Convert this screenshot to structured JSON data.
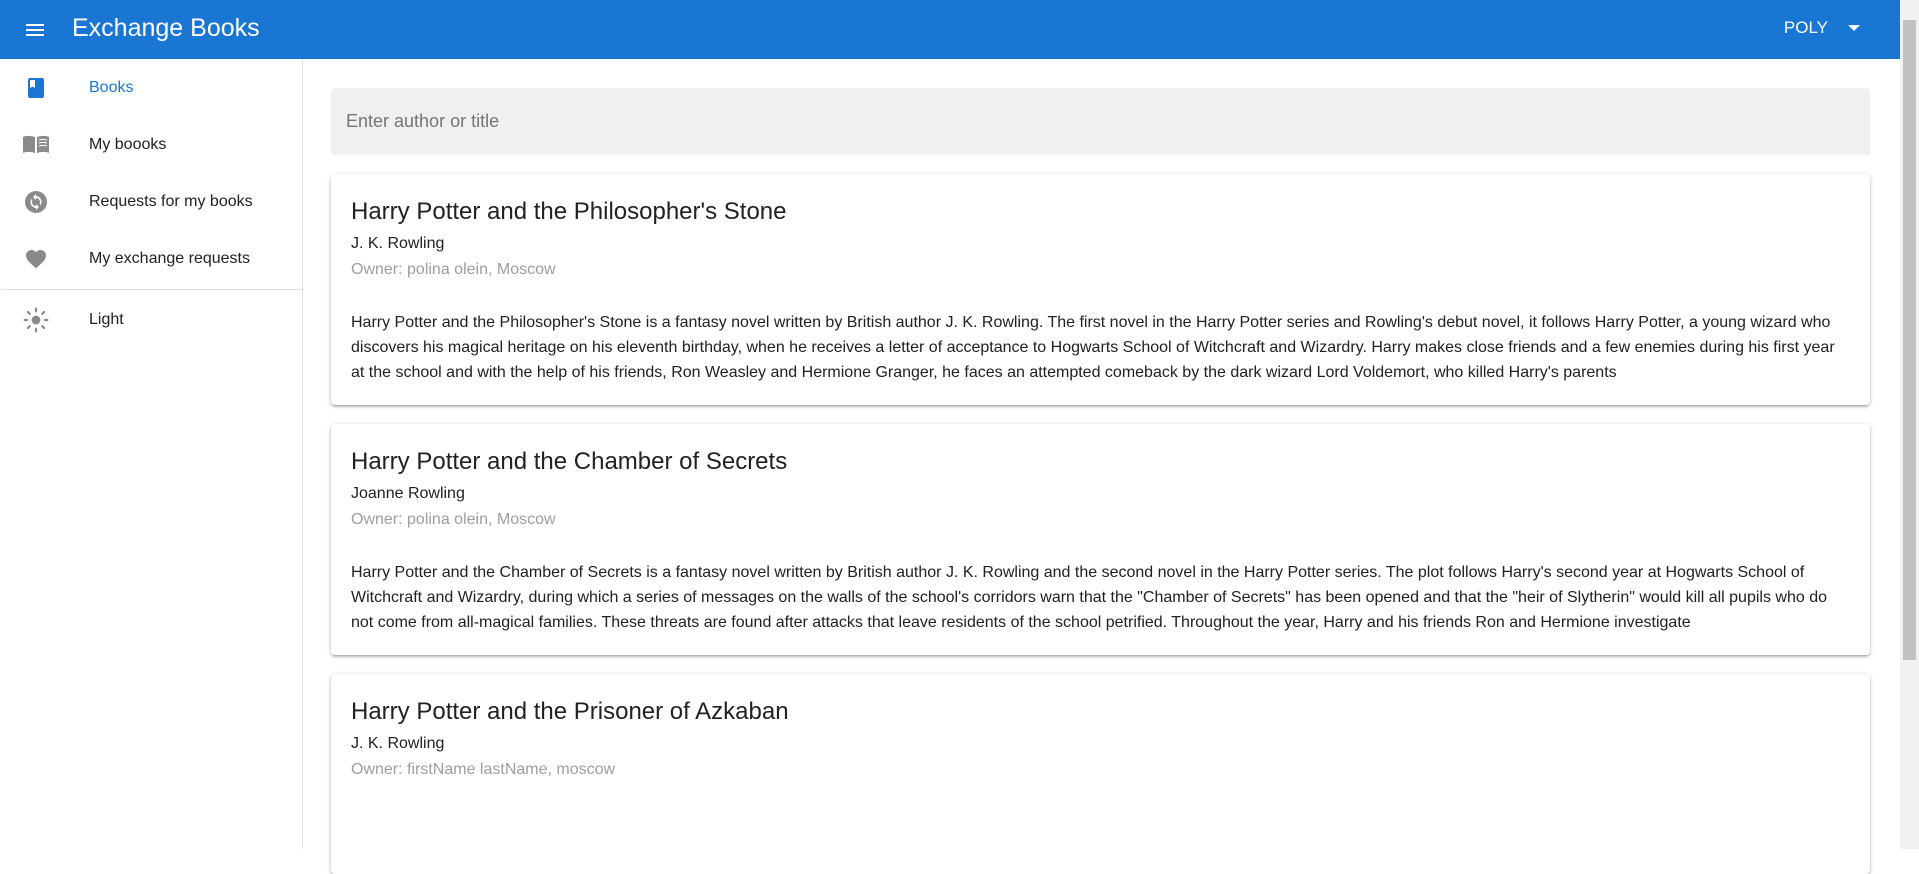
{
  "app": {
    "title": "Exchange Books",
    "brand_color": "#1976d2"
  },
  "user_menu": {
    "label": "POLY"
  },
  "sidebar": {
    "items": [
      {
        "label": "Books",
        "icon": "book-icon",
        "active": true
      },
      {
        "label": "My boooks",
        "icon": "open-book-icon",
        "active": false
      },
      {
        "label": "Requests for my books",
        "icon": "sync-icon",
        "active": false
      },
      {
        "label": "My exchange requests",
        "icon": "heart-icon",
        "active": false
      }
    ],
    "theme": {
      "label": "Light",
      "icon": "sun-icon"
    }
  },
  "search": {
    "placeholder": "Enter author or title",
    "value": ""
  },
  "books": [
    {
      "title": "Harry Potter and the Philosopher's Stone",
      "author": "J. K. Rowling",
      "owner": "Owner: polina olein, Moscow",
      "description": "Harry Potter and the Philosopher's Stone is a fantasy novel written by British author J. K. Rowling. The first novel in the Harry Potter series and Rowling's debut novel, it follows Harry Potter, a young wizard who discovers his magical heritage on his eleventh birthday, when he receives a letter of acceptance to Hogwarts School of Witchcraft and Wizardry. Harry makes close friends and a few enemies during his first year at the school and with the help of his friends, Ron Weasley and Hermione Granger, he faces an attempted comeback by the dark wizard Lord Voldemort, who killed Harry's parents"
    },
    {
      "title": "Harry Potter and the Chamber of Secrets",
      "author": "Joanne Rowling",
      "owner": "Owner: polina olein, Moscow",
      "description": "Harry Potter and the Chamber of Secrets is a fantasy novel written by British author J. K. Rowling and the second novel in the Harry Potter series. The plot follows Harry's second year at Hogwarts School of Witchcraft and Wizardry, during which a series of messages on the walls of the school's corridors warn that the \"Chamber of Secrets\" has been opened and that the \"heir of Slytherin\" would kill all pupils who do not come from all-magical families. These threats are found after attacks that leave residents of the school petrified. Throughout the year, Harry and his friends Ron and Hermione investigate"
    },
    {
      "title": "Harry Potter and the Prisoner of Azkaban",
      "author": "J. K. Rowling",
      "owner": "Owner: firstName lastName, moscow",
      "description": ""
    }
  ]
}
